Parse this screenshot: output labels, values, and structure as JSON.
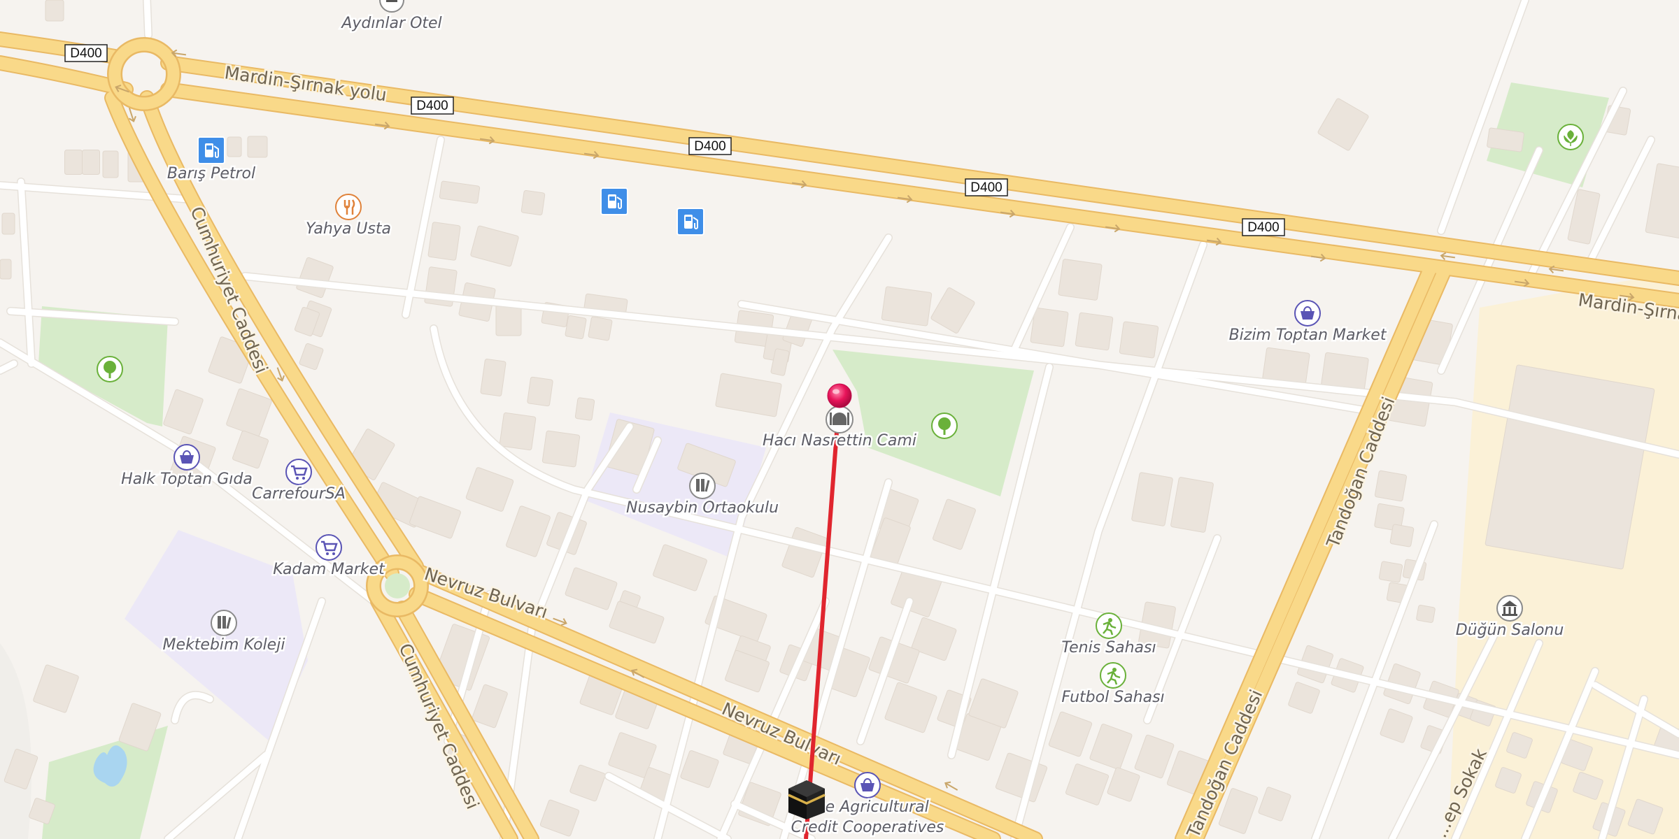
{
  "map": {
    "road_shields": [
      "D400",
      "D400",
      "D400",
      "D400",
      "D400"
    ],
    "streets": {
      "mardin_sirnak_1": "Mardin-Şırnak yolu",
      "mardin_sirnak_2": "Mardin-Şırna",
      "cumhuriyet_1": "Cumhuriyet Caddesi",
      "cumhuriyet_2": "Cumhuriyet Caddesi",
      "nevruz_1": "Nevruz Bulvarı",
      "nevruz_2": "Nevruz Bulvarı",
      "tandogan_1": "Tandoğan Caddesi",
      "tandogan_2": "Tandoğan Caddesi",
      "sokak": "...ep Sokak"
    },
    "pois": {
      "aydinlar_otel": "Aydınlar Otel",
      "baris_petrol": "Barış Petrol",
      "yahya_usta": "Yahya Usta",
      "haci_nasrettin": "Hacı Nasrettin Cami",
      "nusaybin_ortaokulu": "Nusaybin Ortaokulu",
      "bizim_toptan": "Bizim Toptan Market",
      "halk_toptan": "Halk Toptan Gıda",
      "carrefour": "CarrefourSA",
      "kadam_market": "Kadam Market",
      "mektebim_koleji": "Mektebim Koleji",
      "tenis_sahasi": "Tenis Sahası",
      "futbol_sahasi": "Futbol Sahası",
      "dugun_salonu": "Düğün Salonu",
      "agricultural_line1": "The Agricultural",
      "agricultural_line2": "Credit Cooperatives"
    },
    "colors": {
      "land": "#f6f3ef",
      "major_road": "#f9d989",
      "major_road_casing": "#e9b964",
      "minor_road": "#ffffff",
      "park": "#d6ebc9",
      "school": "#ece8f7",
      "industrial": "#fbf1d7",
      "building": "#ebe4dc",
      "qibla_line": "#e0252e",
      "pin": "#e8145a",
      "fuel_icon": "#3f8ee8",
      "shop_icon": "#5a54b5",
      "park_icon": "#6ab13a"
    },
    "icons": {
      "pin": "map-pin-icon",
      "kaaba": "kaaba-icon",
      "fuel": "fuel-station-icon",
      "restaurant": "restaurant-icon",
      "mosque": "mosque-icon",
      "school": "school-icon",
      "shopping_bag": "shopping-bag-icon",
      "shopping_cart": "shopping-cart-icon",
      "tree": "tree-icon",
      "sports": "sports-icon",
      "museum": "venue-icon",
      "hotel": "hotel-icon"
    }
  }
}
